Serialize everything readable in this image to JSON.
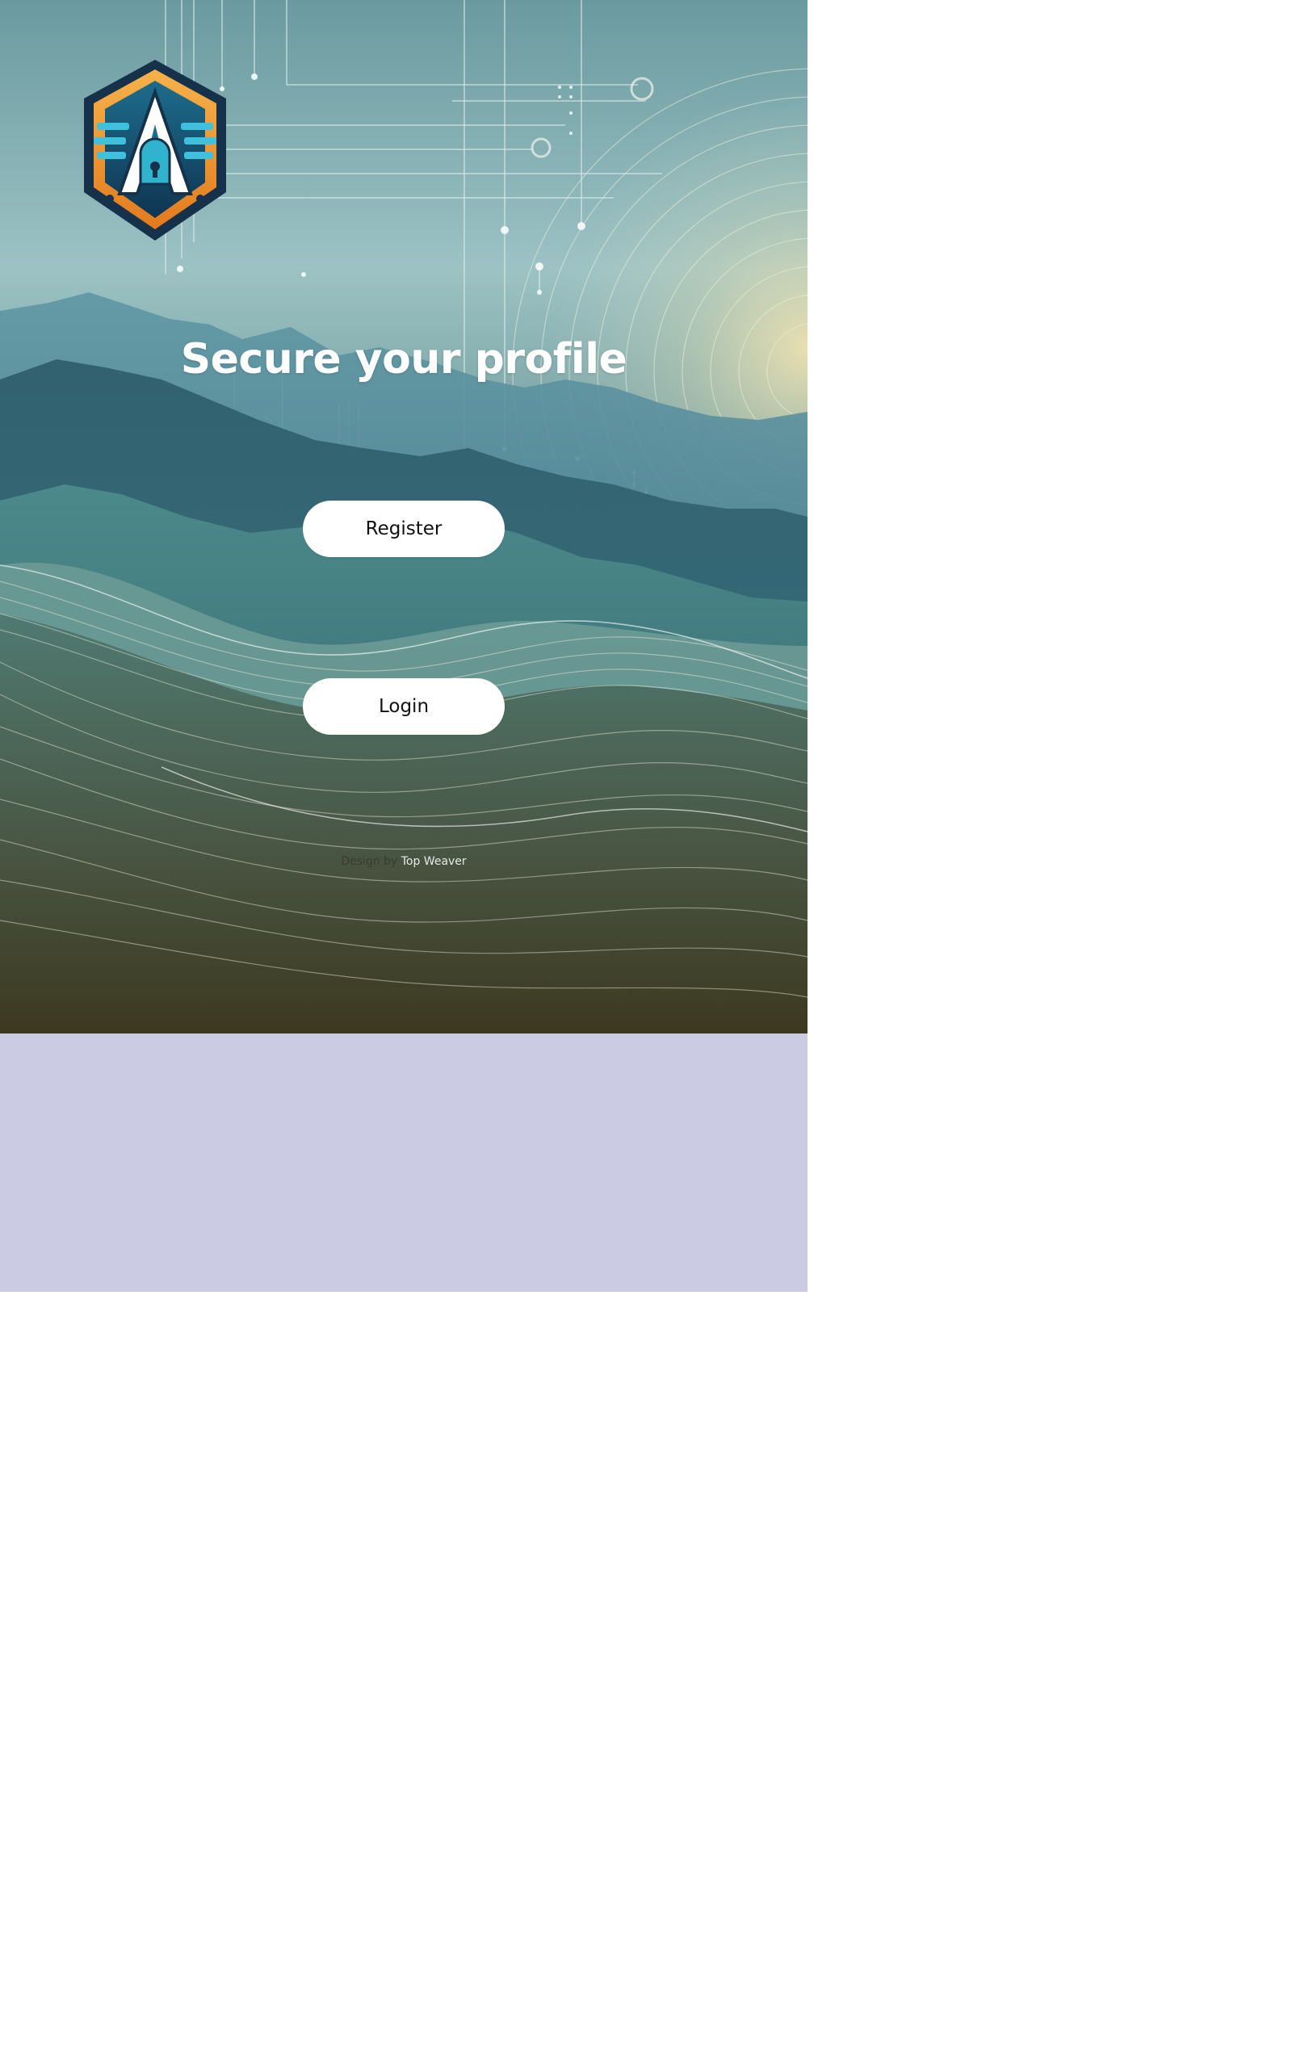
{
  "page": {
    "title": "Secure your profile"
  },
  "actions": {
    "register_label": "Register",
    "login_label": "Login"
  },
  "footer": {
    "credit_prefix": "Design by",
    "credit_author": "Top Weaver"
  },
  "logo": {
    "icon": "shield-a-lock-logo",
    "letter": "A"
  },
  "colors": {
    "below_hero_bg": "#cbcbe3",
    "button_bg": "#ffffff",
    "title_color": "#ffffff",
    "logo_orange": "#f0972e",
    "logo_navy": "#15324a",
    "logo_teal": "#2fb3cf"
  }
}
